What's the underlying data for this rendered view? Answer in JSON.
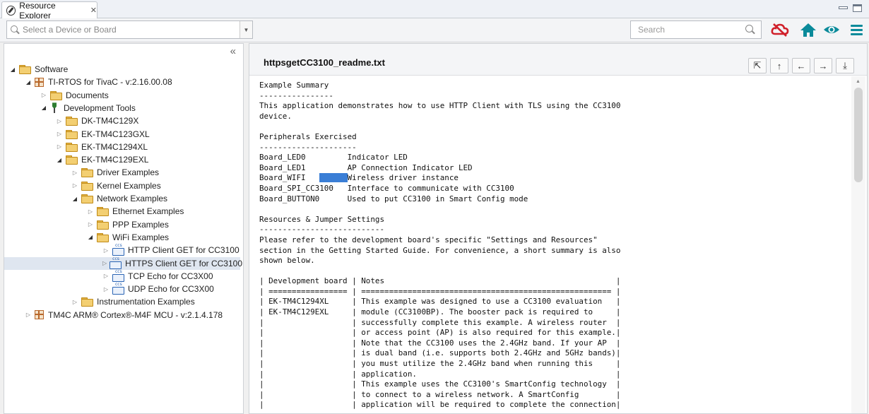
{
  "tab": {
    "title": "Resource Explorer",
    "close": "✕"
  },
  "toolbar": {
    "device_placeholder": "Select a Device or Board",
    "search_placeholder": "Search"
  },
  "tree": [
    {
      "label": "Software",
      "depth": 0,
      "icon": "folder",
      "state": "open"
    },
    {
      "label": "TI-RTOS for TivaC - v:2.16.00.08",
      "depth": 1,
      "icon": "package",
      "state": "open"
    },
    {
      "label": "Documents",
      "depth": 2,
      "icon": "folder",
      "state": "closed"
    },
    {
      "label": "Development Tools",
      "depth": 2,
      "icon": "tools",
      "state": "open"
    },
    {
      "label": "DK-TM4C129X",
      "depth": 3,
      "icon": "folder",
      "state": "closed"
    },
    {
      "label": "EK-TM4C123GXL",
      "depth": 3,
      "icon": "folder",
      "state": "closed"
    },
    {
      "label": "EK-TM4C1294XL",
      "depth": 3,
      "icon": "folder",
      "state": "closed"
    },
    {
      "label": "EK-TM4C129EXL",
      "depth": 3,
      "icon": "folder",
      "state": "open"
    },
    {
      "label": "Driver Examples",
      "depth": 4,
      "icon": "folder",
      "state": "closed"
    },
    {
      "label": "Kernel Examples",
      "depth": 4,
      "icon": "folder",
      "state": "closed"
    },
    {
      "label": "Network Examples",
      "depth": 4,
      "icon": "folder",
      "state": "open"
    },
    {
      "label": "Ethernet Examples",
      "depth": 5,
      "icon": "folder",
      "state": "closed"
    },
    {
      "label": "PPP Examples",
      "depth": 5,
      "icon": "folder",
      "state": "closed"
    },
    {
      "label": "WiFi Examples",
      "depth": 5,
      "icon": "folder",
      "state": "open"
    },
    {
      "label": "HTTP Client GET for CC3100",
      "depth": 6,
      "icon": "ccs",
      "state": "closed"
    },
    {
      "label": "HTTPS Client GET for CC3100",
      "depth": 6,
      "icon": "ccs",
      "state": "closed",
      "selected": true
    },
    {
      "label": "TCP Echo for CC3X00",
      "depth": 6,
      "icon": "ccs",
      "state": "closed"
    },
    {
      "label": "UDP Echo for CC3X00",
      "depth": 6,
      "icon": "ccs",
      "state": "closed"
    },
    {
      "label": "Instrumentation Examples",
      "depth": 4,
      "icon": "folder",
      "state": "closed"
    },
    {
      "label": "TM4C ARM® Cortex®-M4F MCU - v:2.1.4.178",
      "depth": 1,
      "icon": "package",
      "state": "closed"
    }
  ],
  "document": {
    "title": "httpsgetCC3100_readme.txt",
    "lines": [
      "Example Summary",
      "----------------",
      "This application demonstrates how to use HTTP Client with TLS using the CC3100",
      "device.",
      "",
      "Peripherals Exercised",
      "---------------------",
      "Board_LED0         Indicator LED",
      "Board_LED1         AP Connection Indicator LED",
      "Board_WIFI         Wireless driver instance",
      "Board_SPI_CC3100   Interface to communicate with CC3100",
      "Board_BUTTON0      Used to put CC3100 in Smart Config mode",
      "",
      "Resources & Jumper Settings",
      "---------------------------",
      "Please refer to the development board's specific \"Settings and Resources\"",
      "section in the Getting Started Guide. For convenience, a short summary is also",
      "shown below.",
      "",
      "| Development board | Notes                                                  |",
      "| ================= | ====================================================== |",
      "| EK-TM4C1294XL     | This example was designed to use a CC3100 evaluation   |",
      "| EK-TM4C129EXL     | module (CC3100BP). The booster pack is required to     |",
      "|                   | successfully complete this example. A wireless router  |",
      "|                   | or access point (AP) is also required for this example.|",
      "|                   | Note that the CC3100 uses the 2.4GHz band. If your AP  |",
      "|                   | is dual band (i.e. supports both 2.4GHz and 5GHz bands)|",
      "|                   | you must utilize the 2.4GHz band when running this     |",
      "|                   | application.                                           |",
      "|                   | This example uses the CC3100's SmartConfig technology  |",
      "|                   | to connect to a wireless network. A SmartConfig        |",
      "|                   | application will be required to complete the connection|"
    ]
  },
  "colors": {
    "offline_icon": "#d0202a",
    "home_icon": "#0a8a9a",
    "eye_icon": "#0a8a9a",
    "menu_icon": "#0a8a9a",
    "selection_highlight": "#3a7ed6"
  }
}
